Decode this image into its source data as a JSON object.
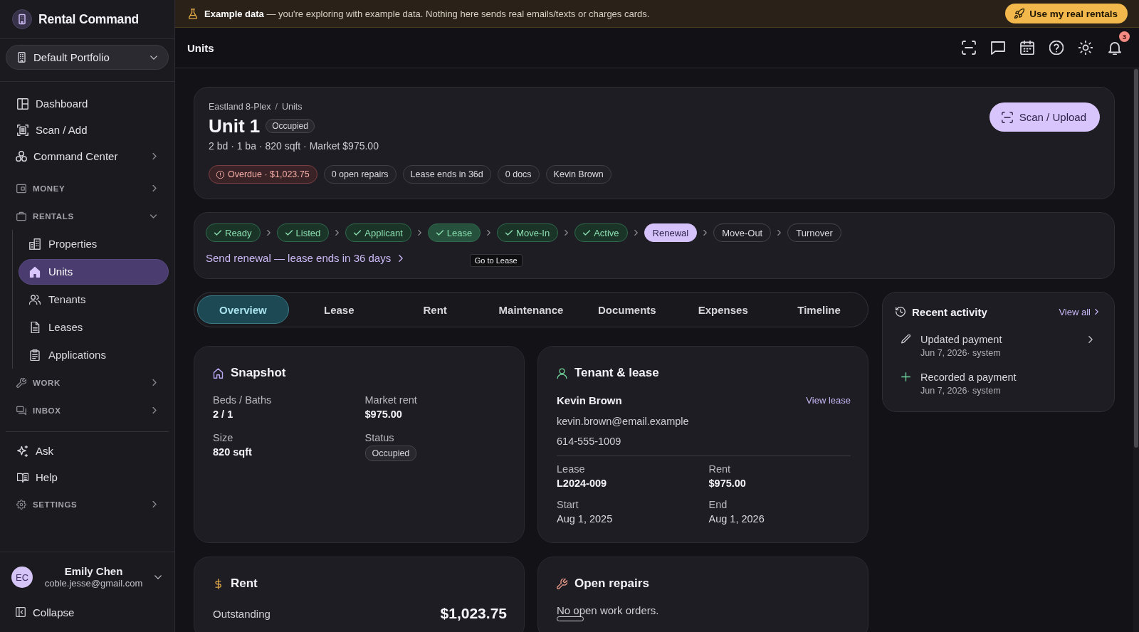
{
  "banner": {
    "message": "**Example data** — you're exploring with example data. Nothing here sends real emails/texts or charges cards.",
    "action": "Use my real rentals"
  },
  "sidebar": {
    "brand": "Rental Command",
    "portfolio": "Default Portfolio",
    "nav": [
      {
        "kind": "link",
        "label": "Dashboard",
        "selected": false
      },
      {
        "kind": "link",
        "label": "Scan / Add",
        "selected": false
      },
      {
        "kind": "menu",
        "label": "Command Center",
        "selected": false,
        "expanded": false
      },
      {
        "kind": "section",
        "label": "MONEY",
        "selected": false,
        "expanded": false
      },
      {
        "kind": "section",
        "label": "RENTALS",
        "selected": false,
        "expanded": true,
        "children": [
          {
            "kind": "link",
            "label": "Properties",
            "selected": false
          },
          {
            "kind": "link",
            "label": "Units",
            "selected": true
          },
          {
            "kind": "link",
            "label": "Tenants",
            "selected": false
          },
          {
            "kind": "link",
            "label": "Leases",
            "selected": false
          },
          {
            "kind": "link",
            "label": "Applications",
            "selected": false
          }
        ]
      },
      {
        "kind": "section",
        "label": "WORK",
        "selected": false,
        "expanded": false
      },
      {
        "kind": "section",
        "label": "INBOX",
        "selected": false,
        "expanded": false
      }
    ],
    "more": [
      {
        "kind": "link",
        "label": "Ask",
        "selected": false
      },
      {
        "kind": "link",
        "label": "Help",
        "selected": false
      },
      {
        "kind": "section",
        "label": "SETTINGS",
        "selected": false,
        "expanded": false
      }
    ],
    "user": {
      "initials": "EC",
      "name": "Emily Chen",
      "email": "coble.jesse@gmail.com"
    },
    "collapse": "Collapse"
  },
  "header": {
    "title": "Units",
    "notifications": "3"
  },
  "unit": {
    "breadcrumb": [
      "Eastland 8-Plex",
      "Units"
    ],
    "separator": "/",
    "title": "Unit 1",
    "status": "Occupied",
    "summary": "2 bd · 1 ba · 820 sqft · Market $975.00",
    "chips": [
      {
        "kind": "alert",
        "label": "Overdue · $1,023.75"
      },
      {
        "kind": "plain",
        "label": "0 open repairs"
      },
      {
        "kind": "plain",
        "label": "Lease ends in 36d"
      },
      {
        "kind": "plain",
        "label": "0 docs"
      },
      {
        "kind": "plain",
        "label": "Kevin Brown"
      }
    ],
    "action": "Scan / Upload"
  },
  "lifecycle": {
    "steps": [
      {
        "label": "Ready",
        "done": true,
        "current": false,
        "hovered": false
      },
      {
        "label": "Listed",
        "done": true,
        "current": false,
        "hovered": false
      },
      {
        "label": "Applicant",
        "done": true,
        "current": false,
        "hovered": false
      },
      {
        "label": "Lease",
        "done": true,
        "current": false,
        "hovered": true
      },
      {
        "label": "Move-In",
        "done": true,
        "current": false,
        "hovered": false
      },
      {
        "label": "Active",
        "done": true,
        "current": false,
        "hovered": false
      },
      {
        "label": "Renewal",
        "done": false,
        "current": true,
        "hovered": false
      },
      {
        "label": "Move-Out",
        "done": false,
        "current": false,
        "hovered": false
      },
      {
        "label": "Turnover",
        "done": false,
        "current": false,
        "hovered": false
      }
    ],
    "next_action": "Send renewal — lease ends in 36 days",
    "tooltip": "Go to Lease"
  },
  "tabs": [
    {
      "label": "Overview",
      "selected": true
    },
    {
      "label": "Lease",
      "selected": false
    },
    {
      "label": "Rent",
      "selected": false
    },
    {
      "label": "Maintenance",
      "selected": false
    },
    {
      "label": "Documents",
      "selected": false
    },
    {
      "label": "Expenses",
      "selected": false
    },
    {
      "label": "Timeline",
      "selected": false
    }
  ],
  "snapshot": {
    "title": "Snapshot",
    "fields": [
      {
        "label": "Beds / Baths",
        "value": "2 / 1",
        "kind": "strong"
      },
      {
        "label": "Market rent",
        "value": "$975.00",
        "kind": "strong"
      },
      {
        "label": "Size",
        "value": "820 sqft",
        "kind": "strong"
      },
      {
        "label": "Status",
        "value": "Occupied",
        "kind": "badge"
      }
    ]
  },
  "tenant": {
    "title": "Tenant & lease",
    "name": "Kevin Brown",
    "link": "View lease",
    "email": "kevin.brown@email.example",
    "phone": "614-555-1009",
    "fields": [
      {
        "label": "Lease",
        "value": "L2024-009",
        "kind": "strong"
      },
      {
        "label": "Rent",
        "value": "$975.00",
        "kind": "strong"
      },
      {
        "label": "Start",
        "value": "Aug 1, 2025",
        "kind": "plain"
      },
      {
        "label": "End",
        "value": "Aug 1, 2026",
        "kind": "plain"
      }
    ]
  },
  "rent": {
    "title": "Rent",
    "rows": [
      {
        "label": "Outstanding",
        "value": "$1,023.75"
      }
    ]
  },
  "repairs": {
    "title": "Open repairs",
    "empty": "No open work orders."
  },
  "activity": {
    "title": "Recent activity",
    "link": "View all",
    "items": [
      {
        "kind": "edit",
        "title": "Updated payment",
        "meta": "Jun 7, 2026· system",
        "hovered": true
      },
      {
        "kind": "add",
        "title": "Recorded a payment",
        "meta": "Jun 7, 2026· system",
        "hovered": false
      }
    ]
  }
}
